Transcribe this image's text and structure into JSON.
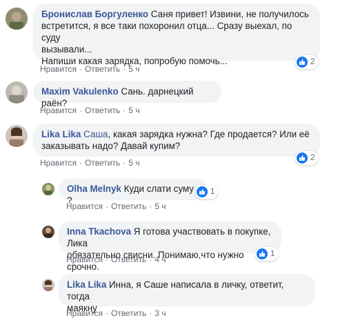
{
  "ui": {
    "like_label": "Нравится",
    "reply_label": "Ответить",
    "sep": "·"
  },
  "comments": [
    {
      "author": "Бронислав Боргуленко",
      "text_lines": [
        "Саня привет! Извини, не получилось",
        "встретится, я все таки похоронил отца... Сразу выехал, по суду",
        "вызывали...",
        "Напиши какая зарядка, попробую помочь..."
      ],
      "time": "5 ч",
      "reactions": "2"
    },
    {
      "author": "Maxim Vakulenko",
      "text": "Сань. дарнецкий раён?",
      "time": "5 ч"
    },
    {
      "author": "Lika Lika",
      "mention": "Саша",
      "text_lines": [
        ", какая зарядка нужна? Где продается? Или её",
        "заказывать надо? Давай купим?"
      ],
      "time": "5 ч",
      "reactions": "2"
    },
    {
      "author": "Olha Melnyk",
      "text": "Куди слати суму ?",
      "time": "5 ч",
      "reactions": "1"
    },
    {
      "author": "Inna Tkachova",
      "text_lines": [
        "Я готова участвовать в покупке, Лика",
        "обязательно свисни. Понимаю,что нужно срочно."
      ],
      "time": "4 ч",
      "reactions": "1"
    },
    {
      "author": "Lika Lika",
      "text_lines": [
        "Инна, я Саше написала в личку, ответит, тогда",
        "маякну"
      ],
      "time": "3 ч"
    }
  ]
}
